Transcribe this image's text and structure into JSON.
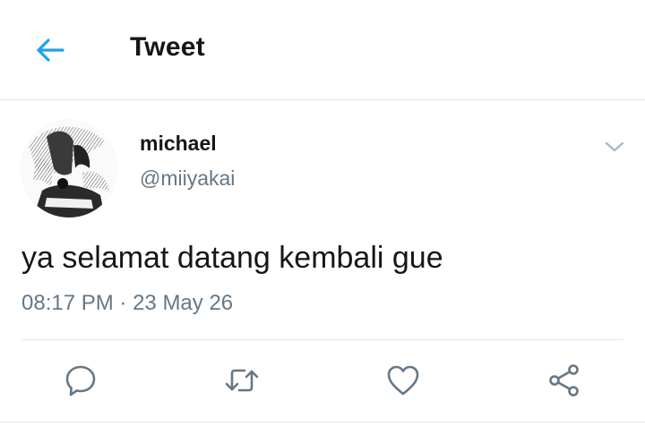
{
  "header": {
    "title": "Tweet",
    "back_icon": "arrow-left-icon"
  },
  "tweet": {
    "author_name": "michael",
    "author_handle": "@miiyakai",
    "text": "ya selamat datang kembali gue",
    "time": "08:17 PM",
    "separator": "·",
    "date": "23 May 26"
  },
  "actions": [
    {
      "name": "reply",
      "icon": "reply-icon"
    },
    {
      "name": "retweet",
      "icon": "retweet-icon"
    },
    {
      "name": "like",
      "icon": "heart-icon"
    },
    {
      "name": "share",
      "icon": "share-icon"
    }
  ],
  "colors": {
    "accent": "#1da1f2",
    "text_primary": "#14171a",
    "text_secondary": "#657786",
    "divider": "#e1e8ed"
  }
}
